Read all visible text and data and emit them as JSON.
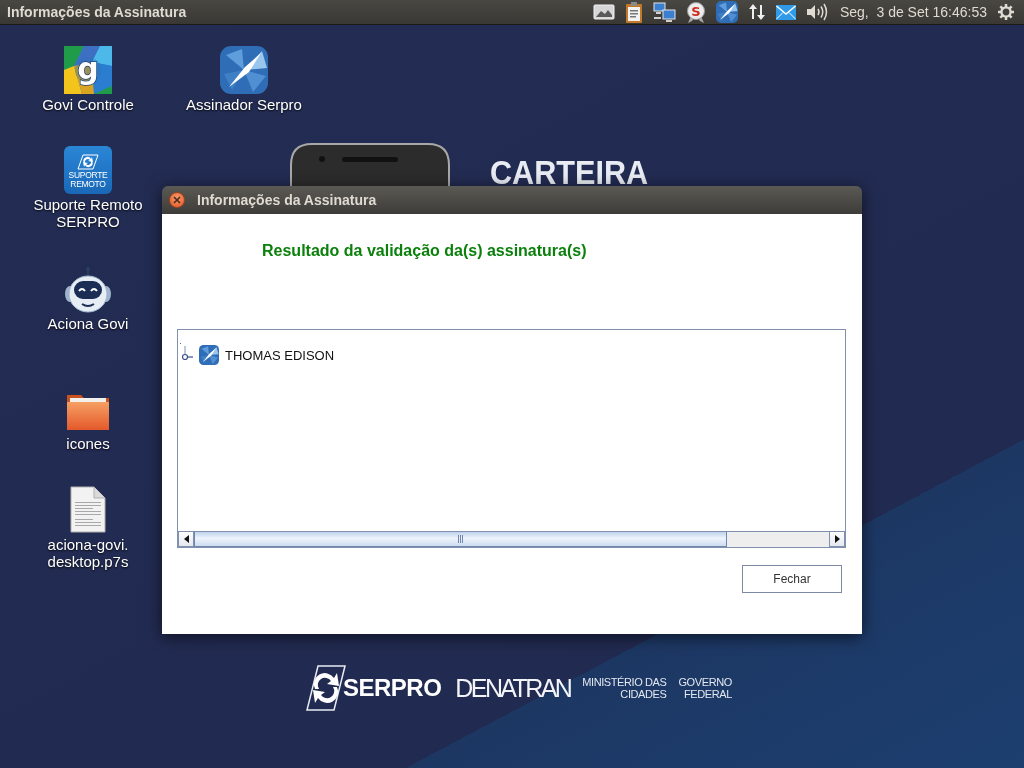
{
  "top_panel": {
    "title": "Informações da Assinatura",
    "indicators": [
      {
        "kind": "image"
      },
      {
        "kind": "clipboard"
      },
      {
        "kind": "network"
      },
      {
        "kind": "badge",
        "text": "S"
      },
      {
        "kind": "signer"
      },
      {
        "kind": "transfer"
      },
      {
        "kind": "mail"
      },
      {
        "kind": "volume"
      }
    ],
    "clock": "Seg,  3 de Set 16:46:53"
  },
  "desktop_icons": [
    {
      "kind": "govi",
      "glyph": "g",
      "label": "Govi Controle"
    },
    {
      "kind": "signer",
      "label": "Assinador Serpro"
    },
    {
      "kind": "support",
      "logo_text": "SUPORTE REMOTO",
      "label": "Suporte Remoto SERPRO"
    },
    {
      "kind": "robot",
      "label": "Aciona Govi"
    },
    {
      "kind": "folder",
      "label": "icones"
    },
    {
      "kind": "document",
      "label": "aciona-govi.desktop.p7s"
    }
  ],
  "wallpaper": {
    "headline": "CARTEIRA",
    "logos": [
      {
        "kind": "serpro",
        "text": "SERPRO"
      },
      {
        "kind": "denatran",
        "text": "DENATRAN"
      },
      {
        "kind": "small",
        "lines": [
          "MINISTÉRIO DAS",
          "CIDADES"
        ]
      },
      {
        "kind": "small",
        "lines": [
          "GOVERNO",
          "FEDERAL"
        ]
      }
    ]
  },
  "dialog": {
    "title": "Informações da Assinatura",
    "heading": "Resultado da validação da(s) assinatura(s)",
    "tree": [
      {
        "label": "THOMAS EDISON",
        "expanded": false
      }
    ],
    "button": "Fechar"
  }
}
